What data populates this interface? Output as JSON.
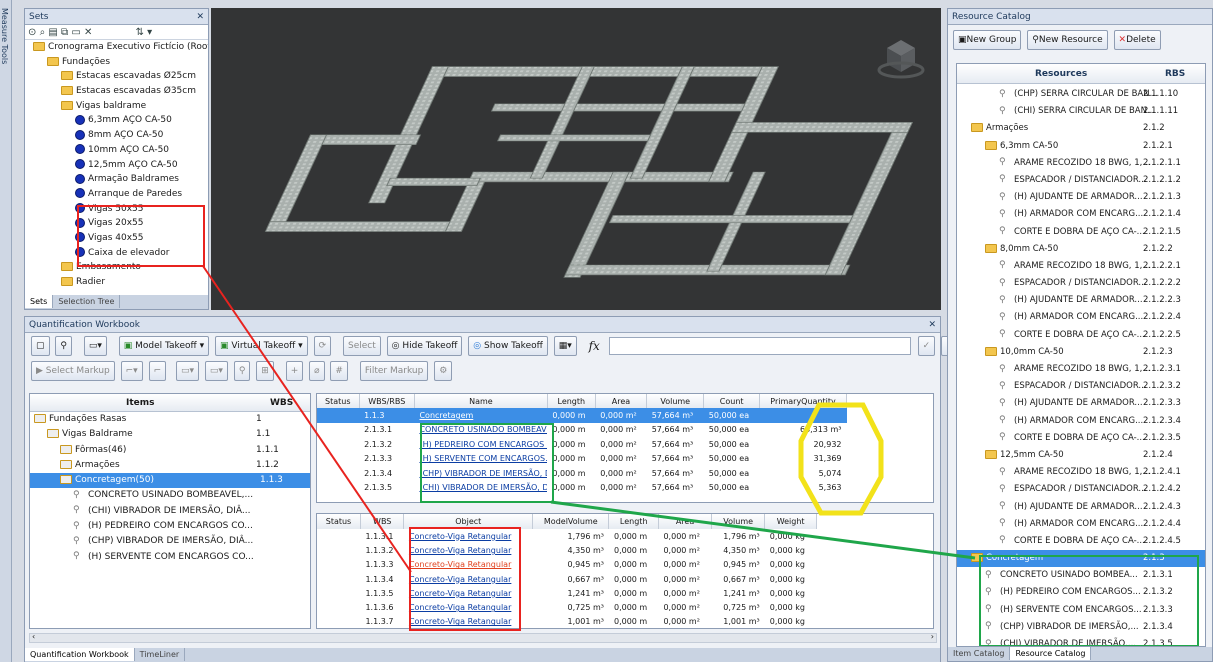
{
  "side_tab": {
    "label": "Measure Tools"
  },
  "sets_panel": {
    "title": "Sets",
    "toolbar_icons": [
      "save-selection-icon",
      "search-icon",
      "new-folder-icon",
      "duplicate-icon",
      "comment-icon",
      "delete-icon",
      "sort-icon",
      "options-icon"
    ],
    "tree": [
      {
        "label": "Cronograma Executivo Fictício (Root)",
        "level": 0,
        "icon": "folder"
      },
      {
        "label": "Fundações",
        "level": 1,
        "icon": "folder"
      },
      {
        "label": "Estacas escavadas Ø25cm",
        "level": 2,
        "icon": "folder"
      },
      {
        "label": "Estacas escavadas Ø35cm",
        "level": 2,
        "icon": "folder"
      },
      {
        "label": "Vigas baldrame",
        "level": 2,
        "icon": "folder"
      },
      {
        "label": "6,3mm AÇO CA-50",
        "level": 3,
        "icon": "set"
      },
      {
        "label": "8mm AÇO CA-50",
        "level": 3,
        "icon": "set"
      },
      {
        "label": "10mm AÇO CA-50",
        "level": 3,
        "icon": "set"
      },
      {
        "label": "12,5mm AÇO CA-50",
        "level": 3,
        "icon": "set"
      },
      {
        "label": "Armação Baldrames",
        "level": 3,
        "icon": "set"
      },
      {
        "label": "Arranque de Paredes",
        "level": 3,
        "icon": "set"
      },
      {
        "label": "Vigas 50x55",
        "level": 3,
        "icon": "set"
      },
      {
        "label": "Vigas 20x55",
        "level": 3,
        "icon": "set"
      },
      {
        "label": "Vigas 40x55",
        "level": 3,
        "icon": "set"
      },
      {
        "label": "Caixa de elevador",
        "level": 3,
        "icon": "set"
      },
      {
        "label": "Embasamento",
        "level": 2,
        "icon": "folder"
      },
      {
        "label": "Radier",
        "level": 2,
        "icon": "folder"
      }
    ],
    "tabs": [
      "Sets",
      "Selection Tree"
    ]
  },
  "viewport": {
    "background": "#333435"
  },
  "workbook": {
    "title": "Quantification Workbook",
    "toolbar1": {
      "model_takeoff": "Model Takeoff",
      "virtual_takeoff": "Virtual Takeoff",
      "select": "Select",
      "hide_takeoff": "Hide Takeoff",
      "show_takeoff": "Show Takeoff",
      "formula_symbol": "fx"
    },
    "toolbar2": {
      "select_markup": "Select Markup",
      "filter_markup": "Filter Markup"
    },
    "items_header": {
      "items": "Items",
      "wbs": "WBS"
    },
    "items": [
      {
        "label": "Fundações Rasas",
        "wbs": "1",
        "level": 0
      },
      {
        "label": "Vigas Baldrame",
        "wbs": "1.1",
        "level": 1
      },
      {
        "label": "Fôrmas(46)",
        "wbs": "1.1.1",
        "level": 2
      },
      {
        "label": "Armações",
        "wbs": "1.1.2",
        "level": 2
      },
      {
        "label": "Concretagem(50)",
        "wbs": "1.1.3",
        "level": 2,
        "selected": true
      },
      {
        "label": "CONCRETO USINADO BOMBEAVEL,...",
        "wbs": "",
        "level": 3
      },
      {
        "label": "(CHI) VIBRADOR DE IMERSÃO, DIÂ...",
        "wbs": "",
        "level": 3
      },
      {
        "label": "(H) PEDREIRO COM ENCARGOS CO...",
        "wbs": "",
        "level": 3
      },
      {
        "label": "(CHP) VIBRADOR DE IMERSÃO, DIÂ...",
        "wbs": "",
        "level": 3
      },
      {
        "label": "(H) SERVENTE COM ENCARGOS CO...",
        "wbs": "",
        "level": 3
      }
    ],
    "top_table": {
      "headers": [
        "Status",
        "WBS/RBS",
        "Name",
        "Length",
        "Area",
        "Volume",
        "Count",
        "PrimaryQuantity"
      ],
      "rows": [
        {
          "wbs": "1.1.3",
          "name": "Concretagem",
          "length": "0,000 m",
          "area": "0,000 m²",
          "volume": "57,664 m³",
          "count": "50,000 ea",
          "pq": "",
          "selected": true
        },
        {
          "wbs": "2.1.3.1",
          "name": "CONCRETO USINADO BOMBEAVE",
          "length": "0,000 m",
          "area": "0,000 m²",
          "volume": "57,664 m³",
          "count": "50,000 ea",
          "pq": "66,313 m³"
        },
        {
          "wbs": "2.1.3.2",
          "name": "(H) PEDREIRO COM ENCARGOS C",
          "length": "0,000 m",
          "area": "0,000 m²",
          "volume": "57,664 m³",
          "count": "50,000 ea",
          "pq": "20,932"
        },
        {
          "wbs": "2.1.3.3",
          "name": "(H) SERVENTE COM ENCARGOS...",
          "length": "0,000 m",
          "area": "0,000 m²",
          "volume": "57,664 m³",
          "count": "50,000 ea",
          "pq": "31,369"
        },
        {
          "wbs": "2.1.3.4",
          "name": "(CHP) VIBRADOR DE IMERSÃO, D...",
          "length": "0,000 m",
          "area": "0,000 m²",
          "volume": "57,664 m³",
          "count": "50,000 ea",
          "pq": "5,074"
        },
        {
          "wbs": "2.1.3.5",
          "name": "(CHI) VIBRADOR DE IMERSÃO, D...",
          "length": "0,000 m",
          "area": "0,000 m²",
          "volume": "57,664 m³",
          "count": "50,000 ea",
          "pq": "5,363"
        }
      ]
    },
    "bottom_table": {
      "headers": [
        "Status",
        "WBS",
        "Object",
        "ModelVolume",
        "Length",
        "Area",
        "Volume",
        "Weight"
      ],
      "rows": [
        {
          "wbs": "1.1.3.1",
          "object": "Concreto-Viga Retangular",
          "mv": "1,796 m³",
          "length": "0,000 m",
          "area": "0,000 m²",
          "volume": "1,796 m³",
          "weight": "0,000 kg"
        },
        {
          "wbs": "1.1.3.2",
          "object": "Concreto-Viga Retangular",
          "mv": "4,350 m³",
          "length": "0,000 m",
          "area": "0,000 m²",
          "volume": "4,350 m³",
          "weight": "0,000 kg"
        },
        {
          "wbs": "1.1.3.3",
          "object": "Concreto-Viga Retangular",
          "mv": "0,945 m³",
          "length": "0,000 m",
          "area": "0,000 m²",
          "volume": "0,945 m³",
          "weight": "0,000 kg",
          "highlight": true
        },
        {
          "wbs": "1.1.3.4",
          "object": "Concreto-Viga Retangular",
          "mv": "0,667 m³",
          "length": "0,000 m",
          "area": "0,000 m²",
          "volume": "0,667 m³",
          "weight": "0,000 kg"
        },
        {
          "wbs": "1.1.3.5",
          "object": "Concreto-Viga Retangular",
          "mv": "1,241 m³",
          "length": "0,000 m",
          "area": "0,000 m²",
          "volume": "1,241 m³",
          "weight": "0,000 kg"
        },
        {
          "wbs": "1.1.3.6",
          "object": "Concreto-Viga Retangular",
          "mv": "0,725 m³",
          "length": "0,000 m",
          "area": "0,000 m²",
          "volume": "0,725 m³",
          "weight": "0,000 kg"
        },
        {
          "wbs": "1.1.3.7",
          "object": "Concreto-Viga Retangular",
          "mv": "1,001 m³",
          "length": "0,000 m",
          "area": "0,000 m²",
          "volume": "1,001 m³",
          "weight": "0,000 kg"
        }
      ]
    },
    "tabs": [
      "Quantification Workbook",
      "TimeLiner"
    ]
  },
  "resource_catalog": {
    "title": "Resource Catalog",
    "new_group": "New Group",
    "new_resource": "New Resource",
    "delete": "Delete",
    "headers": {
      "resources": "Resources",
      "rbs": "RBS"
    },
    "rows": [
      {
        "label": "(CHP) SERRA CIRCULAR DE BAN...",
        "rbs": "2.1.1.10",
        "level": 2,
        "icon": "wrench"
      },
      {
        "label": "(CHI) SERRA CIRCULAR DE BAN...",
        "rbs": "2.1.1.11",
        "level": 2,
        "icon": "wrench"
      },
      {
        "label": "Armações",
        "rbs": "2.1.2",
        "level": 0,
        "icon": "folder"
      },
      {
        "label": "6,3mm CA-50",
        "rbs": "2.1.2.1",
        "level": 1,
        "icon": "folder"
      },
      {
        "label": "ARAME RECOZIDO 18 BWG, 1,...",
        "rbs": "2.1.2.1.1",
        "level": 2,
        "icon": "wrench"
      },
      {
        "label": "ESPACADOR / DISTANCIADOR...",
        "rbs": "2.1.2.1.2",
        "level": 2,
        "icon": "wrench"
      },
      {
        "label": "(H) AJUDANTE DE ARMADOR...",
        "rbs": "2.1.2.1.3",
        "level": 2,
        "icon": "wrench"
      },
      {
        "label": "(H) ARMADOR COM ENCARG...",
        "rbs": "2.1.2.1.4",
        "level": 2,
        "icon": "wrench"
      },
      {
        "label": "CORTE E DOBRA DE AÇO CA-...",
        "rbs": "2.1.2.1.5",
        "level": 2,
        "icon": "wrench"
      },
      {
        "label": "8,0mm CA-50",
        "rbs": "2.1.2.2",
        "level": 1,
        "icon": "folder"
      },
      {
        "label": "ARAME RECOZIDO 18 BWG, 1,...",
        "rbs": "2.1.2.2.1",
        "level": 2,
        "icon": "wrench"
      },
      {
        "label": "ESPACADOR / DISTANCIADOR...",
        "rbs": "2.1.2.2.2",
        "level": 2,
        "icon": "wrench"
      },
      {
        "label": "(H) AJUDANTE DE ARMADOR...",
        "rbs": "2.1.2.2.3",
        "level": 2,
        "icon": "wrench"
      },
      {
        "label": "(H) ARMADOR COM ENCARG...",
        "rbs": "2.1.2.2.4",
        "level": 2,
        "icon": "wrench"
      },
      {
        "label": "CORTE E DOBRA DE AÇO CA-...",
        "rbs": "2.1.2.2.5",
        "level": 2,
        "icon": "wrench"
      },
      {
        "label": "10,0mm CA-50",
        "rbs": "2.1.2.3",
        "level": 1,
        "icon": "folder"
      },
      {
        "label": "ARAME RECOZIDO 18 BWG, 1,...",
        "rbs": "2.1.2.3.1",
        "level": 2,
        "icon": "wrench"
      },
      {
        "label": "ESPACADOR / DISTANCIADOR...",
        "rbs": "2.1.2.3.2",
        "level": 2,
        "icon": "wrench"
      },
      {
        "label": "(H) AJUDANTE DE ARMADOR...",
        "rbs": "2.1.2.3.3",
        "level": 2,
        "icon": "wrench"
      },
      {
        "label": "(H) ARMADOR COM ENCARG...",
        "rbs": "2.1.2.3.4",
        "level": 2,
        "icon": "wrench"
      },
      {
        "label": "CORTE E DOBRA DE AÇO CA-...",
        "rbs": "2.1.2.3.5",
        "level": 2,
        "icon": "wrench"
      },
      {
        "label": "12,5mm CA-50",
        "rbs": "2.1.2.4",
        "level": 1,
        "icon": "folder"
      },
      {
        "label": "ARAME RECOZIDO 18 BWG, 1,...",
        "rbs": "2.1.2.4.1",
        "level": 2,
        "icon": "wrench"
      },
      {
        "label": "ESPACADOR / DISTANCIADOR...",
        "rbs": "2.1.2.4.2",
        "level": 2,
        "icon": "wrench"
      },
      {
        "label": "(H) AJUDANTE DE ARMADOR...",
        "rbs": "2.1.2.4.3",
        "level": 2,
        "icon": "wrench"
      },
      {
        "label": "(H) ARMADOR COM ENCARG...",
        "rbs": "2.1.2.4.4",
        "level": 2,
        "icon": "wrench"
      },
      {
        "label": "CORTE E DOBRA DE AÇO CA-...",
        "rbs": "2.1.2.4.5",
        "level": 2,
        "icon": "wrench"
      },
      {
        "label": "Concretagem",
        "rbs": "2.1.3",
        "level": 0,
        "icon": "folder",
        "selected": true
      },
      {
        "label": "CONCRETO USINADO BOMBEA...",
        "rbs": "2.1.3.1",
        "level": 1,
        "icon": "wrench"
      },
      {
        "label": "(H) PEDREIRO COM ENCARGOS...",
        "rbs": "2.1.3.2",
        "level": 1,
        "icon": "wrench"
      },
      {
        "label": "(H) SERVENTE COM ENCARGOS...",
        "rbs": "2.1.3.3",
        "level": 1,
        "icon": "wrench"
      },
      {
        "label": "(CHP) VIBRADOR DE IMERSÃO,...",
        "rbs": "2.1.3.4",
        "level": 1,
        "icon": "wrench"
      },
      {
        "label": "(CHI) VIBRADOR DE IMERSÃO,...",
        "rbs": "2.1.3.5",
        "level": 1,
        "icon": "wrench"
      }
    ],
    "tabs": [
      "Item Catalog",
      "Resource Catalog"
    ]
  },
  "annotation_colors": {
    "red": "#e8231f",
    "green": "#1fa64a",
    "yellow": "#f2e21a",
    "selection": "#3c8ee6"
  }
}
